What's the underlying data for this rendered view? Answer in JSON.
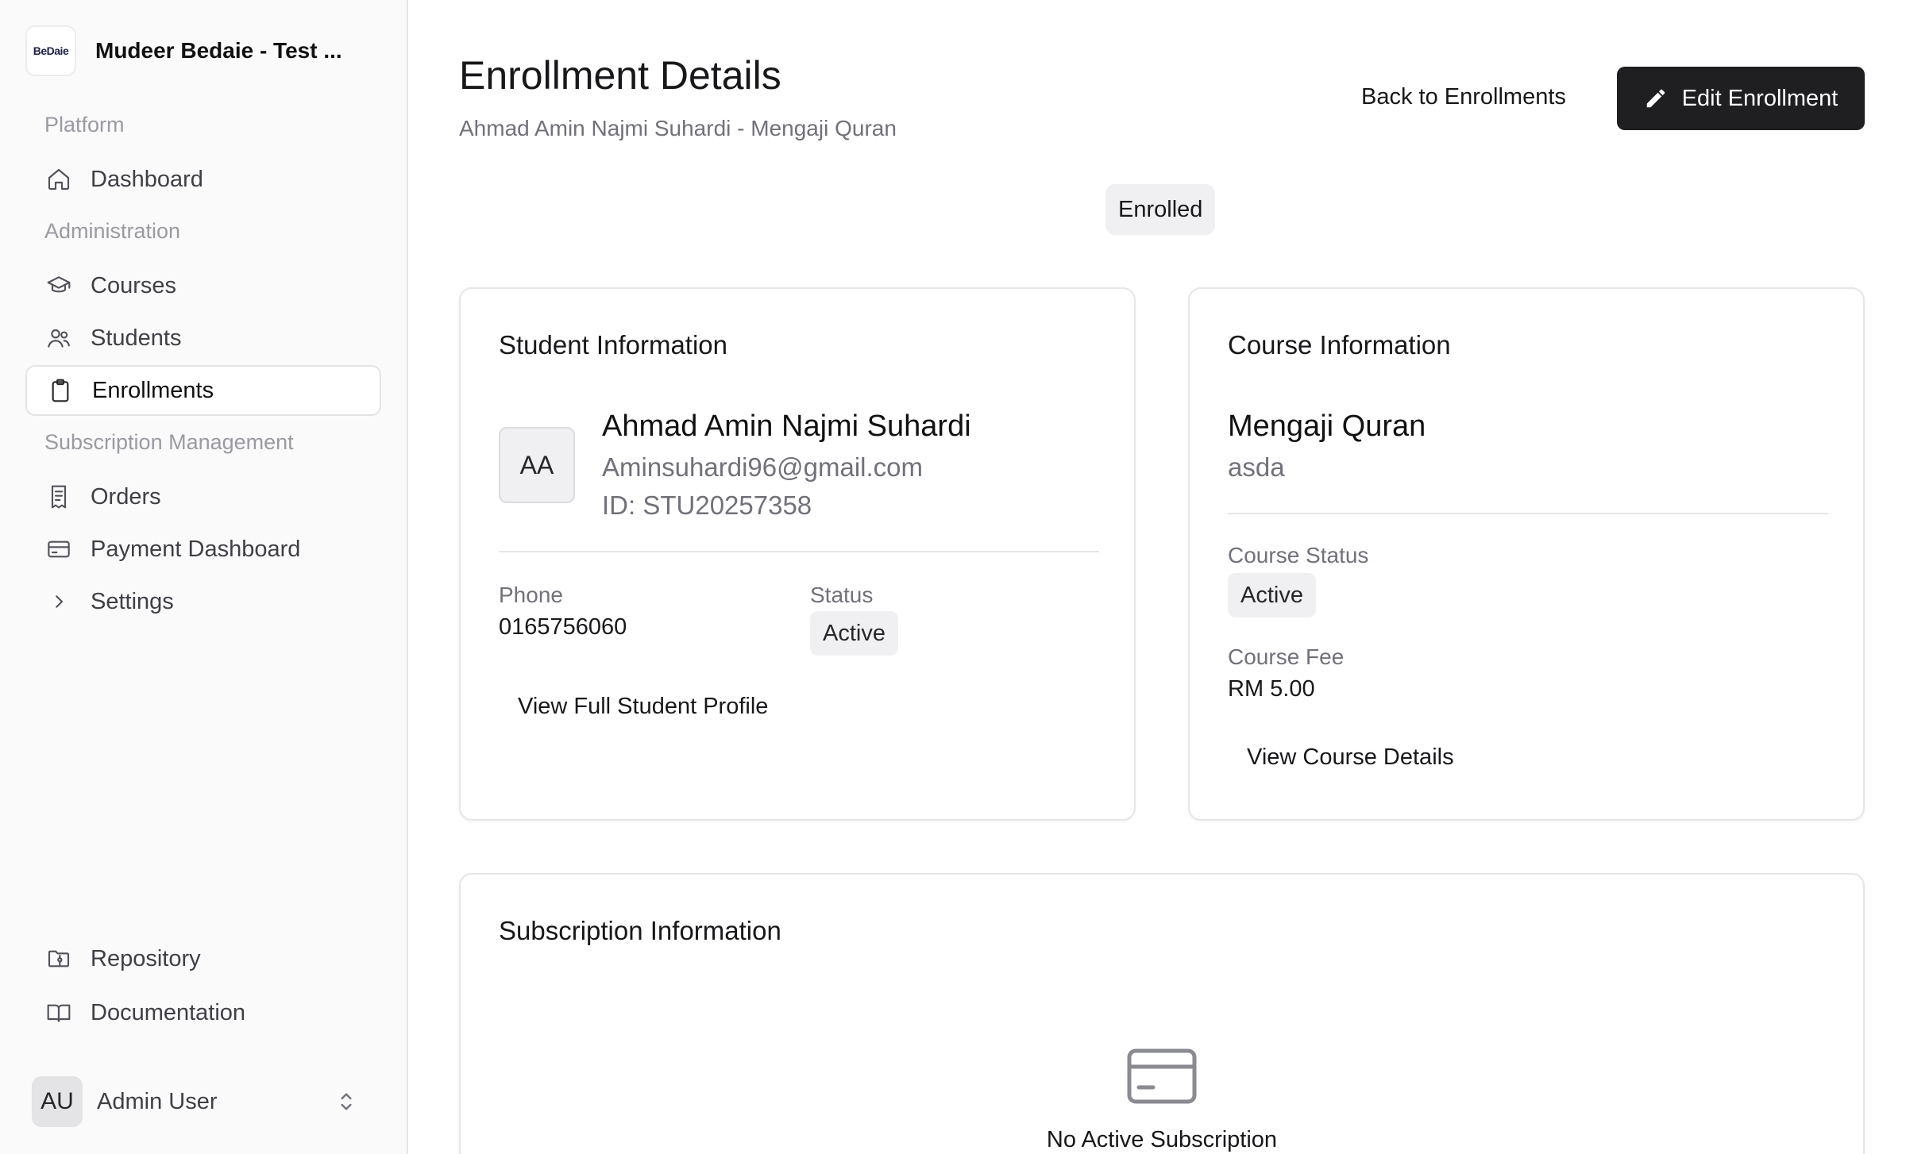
{
  "sidebar": {
    "brand_logo_text": "BeDaie",
    "brand_name": "Mudeer Bedaie - Test ...",
    "groups": {
      "platform": "Platform",
      "administration": "Administration",
      "subscription": "Subscription Management"
    },
    "items": [
      {
        "label": "Dashboard",
        "icon": "home-icon"
      },
      {
        "label": "Courses",
        "icon": "graduation-cap-icon"
      },
      {
        "label": "Students",
        "icon": "users-icon"
      },
      {
        "label": "Enrollments",
        "icon": "clipboard-icon",
        "active": true
      },
      {
        "label": "Orders",
        "icon": "receipt-icon"
      },
      {
        "label": "Payment Dashboard",
        "icon": "credit-card-icon"
      },
      {
        "label": "Settings",
        "icon": "chevron-right-icon"
      },
      {
        "label": "Repository",
        "icon": "folder-git-icon"
      },
      {
        "label": "Documentation",
        "icon": "book-open-icon"
      }
    ],
    "user": {
      "initials": "AU",
      "name": "Admin User"
    }
  },
  "header": {
    "title": "Enrollment Details",
    "subtitle": "Ahmad Amin Najmi Suhardi - Mengaji Quran",
    "back_label": "Back to Enrollments",
    "edit_label": "Edit Enrollment",
    "status": "Enrolled"
  },
  "student": {
    "title": "Student Information",
    "initials": "AA",
    "name": "Ahmad Amin Najmi Suhardi",
    "email": "Aminsuhardi96@gmail.com",
    "id": "ID: STU20257358",
    "phone_label": "Phone",
    "phone": "0165756060",
    "status_label": "Status",
    "status": "Active",
    "profile_link": "View Full Student Profile"
  },
  "course": {
    "title": "Course Information",
    "name": "Mengaji Quran",
    "description": "asda",
    "status_label": "Course Status",
    "status": "Active",
    "fee_label": "Course Fee",
    "fee": "RM 5.00",
    "details_link": "View Course Details"
  },
  "subscription": {
    "title": "Subscription Information",
    "empty_text": "No Active Subscription"
  },
  "colors": {
    "primary_button": "#1f1f22",
    "muted_text": "#71717a",
    "sidebar_bg": "#fafafa",
    "badge_bg": "#f0f0f2"
  }
}
